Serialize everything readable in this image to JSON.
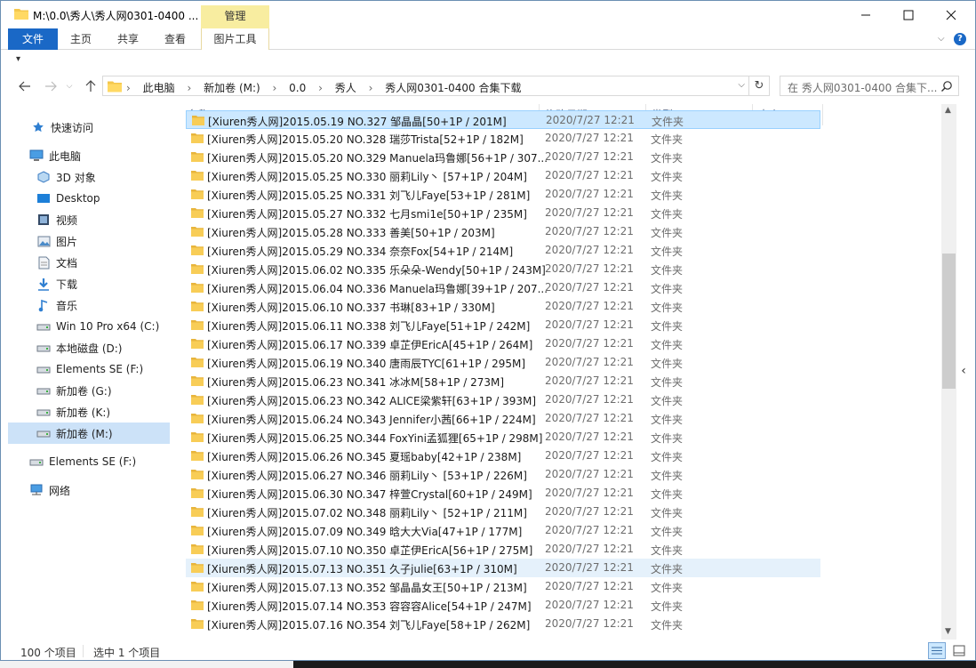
{
  "window": {
    "title": "M:\\0.0\\秀人\\秀人网0301-0400 ...",
    "manage_label": "管理"
  },
  "ribbon": {
    "tabs": [
      "文件",
      "主页",
      "共享",
      "查看",
      "图片工具"
    ]
  },
  "address": {
    "crumbs": [
      "此电脑",
      "新加卷 (M:)",
      "0.0",
      "秀人",
      "秀人网0301-0400 合集下载"
    ],
    "search_placeholder": "在 秀人网0301-0400 合集下..."
  },
  "nav": {
    "items": [
      {
        "label": "快速访问",
        "icon": "star-icon"
      },
      {
        "label": "此电脑",
        "icon": "computer-icon"
      },
      {
        "label": "3D 对象",
        "icon": "cube-icon"
      },
      {
        "label": "Desktop",
        "icon": "desktop-icon"
      },
      {
        "label": "视频",
        "icon": "video-icon"
      },
      {
        "label": "图片",
        "icon": "picture-icon"
      },
      {
        "label": "文档",
        "icon": "document-icon"
      },
      {
        "label": "下载",
        "icon": "download-icon"
      },
      {
        "label": "音乐",
        "icon": "music-icon"
      },
      {
        "label": "Win 10 Pro x64 (C:)",
        "icon": "drive-icon"
      },
      {
        "label": "本地磁盘 (D:)",
        "icon": "drive-icon"
      },
      {
        "label": "Elements SE (F:)",
        "icon": "drive-icon"
      },
      {
        "label": "新加卷 (G:)",
        "icon": "drive-icon"
      },
      {
        "label": "新加卷 (K:)",
        "icon": "drive-icon"
      },
      {
        "label": "新加卷 (M:)",
        "icon": "drive-icon"
      },
      {
        "label": "Elements SE (F:)",
        "icon": "drive-icon"
      },
      {
        "label": "网络",
        "icon": "network-icon"
      }
    ]
  },
  "columns": [
    "名称",
    "修改日期",
    "类型",
    "大小"
  ],
  "files": [
    {
      "name": "[Xiuren秀人网]2015.05.19 NO.327 邹晶晶[50+1P / 201M]",
      "date": "2020/7/27 12:21",
      "type": "文件夹"
    },
    {
      "name": "[Xiuren秀人网]2015.05.20 NO.328 瑞莎Trista[52+1P / 182M]",
      "date": "2020/7/27 12:21",
      "type": "文件夹"
    },
    {
      "name": "[Xiuren秀人网]2015.05.20 NO.329 Manuela玛鲁娜[56+1P / 307...",
      "date": "2020/7/27 12:21",
      "type": "文件夹"
    },
    {
      "name": "[Xiuren秀人网]2015.05.25 NO.330 丽莉Lily丶 [57+1P / 204M]",
      "date": "2020/7/27 12:21",
      "type": "文件夹"
    },
    {
      "name": "[Xiuren秀人网]2015.05.25 NO.331 刘飞儿Faye[53+1P / 281M]",
      "date": "2020/7/27 12:21",
      "type": "文件夹"
    },
    {
      "name": "[Xiuren秀人网]2015.05.27 NO.332 七月smi1e[50+1P / 235M]",
      "date": "2020/7/27 12:21",
      "type": "文件夹"
    },
    {
      "name": "[Xiuren秀人网]2015.05.28 NO.333 善美[50+1P / 203M]",
      "date": "2020/7/27 12:21",
      "type": "文件夹"
    },
    {
      "name": "[Xiuren秀人网]2015.05.29 NO.334 奈奈Fox[54+1P / 214M]",
      "date": "2020/7/27 12:21",
      "type": "文件夹"
    },
    {
      "name": "[Xiuren秀人网]2015.06.02 NO.335 乐朵朵-Wendy[50+1P / 243M]",
      "date": "2020/7/27 12:21",
      "type": "文件夹"
    },
    {
      "name": "[Xiuren秀人网]2015.06.04 NO.336 Manuela玛鲁娜[39+1P / 207...",
      "date": "2020/7/27 12:21",
      "type": "文件夹"
    },
    {
      "name": "[Xiuren秀人网]2015.06.10 NO.337 书琳[83+1P / 330M]",
      "date": "2020/7/27 12:21",
      "type": "文件夹"
    },
    {
      "name": "[Xiuren秀人网]2015.06.11 NO.338 刘飞儿Faye[51+1P / 242M]",
      "date": "2020/7/27 12:21",
      "type": "文件夹"
    },
    {
      "name": "[Xiuren秀人网]2015.06.17 NO.339 卓芷伊EricA[45+1P / 264M]",
      "date": "2020/7/27 12:21",
      "type": "文件夹"
    },
    {
      "name": "[Xiuren秀人网]2015.06.19 NO.340 唐雨辰TYC[61+1P / 295M]",
      "date": "2020/7/27 12:21",
      "type": "文件夹"
    },
    {
      "name": "[Xiuren秀人网]2015.06.23 NO.341 冰冰M[58+1P / 273M]",
      "date": "2020/7/27 12:21",
      "type": "文件夹"
    },
    {
      "name": "[Xiuren秀人网]2015.06.23 NO.342 ALICE梁紫轩[63+1P / 393M]",
      "date": "2020/7/27 12:21",
      "type": "文件夹"
    },
    {
      "name": "[Xiuren秀人网]2015.06.24 NO.343 Jennifer小茜[66+1P / 224M]",
      "date": "2020/7/27 12:21",
      "type": "文件夹"
    },
    {
      "name": "[Xiuren秀人网]2015.06.25 NO.344 FoxYini孟狐狸[65+1P / 298M]",
      "date": "2020/7/27 12:21",
      "type": "文件夹"
    },
    {
      "name": "[Xiuren秀人网]2015.06.26 NO.345 夏瑶baby[42+1P / 238M]",
      "date": "2020/7/27 12:21",
      "type": "文件夹"
    },
    {
      "name": "[Xiuren秀人网]2015.06.27 NO.346 丽莉Lily丶 [53+1P / 226M]",
      "date": "2020/7/27 12:21",
      "type": "文件夹"
    },
    {
      "name": "[Xiuren秀人网]2015.06.30 NO.347 梓萱Crystal[60+1P / 249M]",
      "date": "2020/7/27 12:21",
      "type": "文件夹"
    },
    {
      "name": "[Xiuren秀人网]2015.07.02 NO.348 丽莉Lily丶 [52+1P / 211M]",
      "date": "2020/7/27 12:21",
      "type": "文件夹"
    },
    {
      "name": "[Xiuren秀人网]2015.07.09 NO.349 晗大大Via[47+1P / 177M]",
      "date": "2020/7/27 12:21",
      "type": "文件夹"
    },
    {
      "name": "[Xiuren秀人网]2015.07.10 NO.350 卓芷伊EricA[56+1P / 275M]",
      "date": "2020/7/27 12:21",
      "type": "文件夹"
    },
    {
      "name": "[Xiuren秀人网]2015.07.13 NO.351 久子julie[63+1P / 310M]",
      "date": "2020/7/27 12:21",
      "type": "文件夹"
    },
    {
      "name": "[Xiuren秀人网]2015.07.13 NO.352 邹晶晶女王[50+1P / 213M]",
      "date": "2020/7/27 12:21",
      "type": "文件夹"
    },
    {
      "name": "[Xiuren秀人网]2015.07.14 NO.353 容容容Alice[54+1P / 247M]",
      "date": "2020/7/27 12:21",
      "type": "文件夹"
    },
    {
      "name": "[Xiuren秀人网]2015.07.16 NO.354 刘飞儿Faye[58+1P / 262M]",
      "date": "2020/7/27 12:21",
      "type": "文件夹"
    }
  ],
  "status": {
    "count": "100 个项目",
    "selected": "选中 1 个项目"
  },
  "colors": {
    "accent": "#1a68c6",
    "folder": "#f4c74d",
    "selected_row": "#cce8ff",
    "hover_row": "#e5f1fb"
  }
}
